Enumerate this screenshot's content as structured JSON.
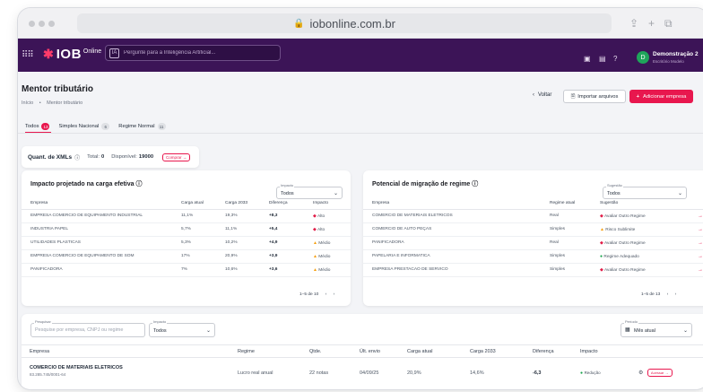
{
  "browser": {
    "url": "iobonline.com.br"
  },
  "nav": {
    "logo_brand": "IOB",
    "logo_suffix": "Online",
    "ai_placeholder": "Pergunte para a Inteligência Artificial...",
    "user_initial": "D",
    "user_name": "Demonstração 2",
    "user_company": "Escritório Modelo"
  },
  "header": {
    "title": "Mentor tributário",
    "breadcrumb": [
      "Início",
      "•",
      "Mentor tributário"
    ],
    "back_label": "Voltar",
    "import_label": "Importar arquivos",
    "add_label": "Adicionar empresa"
  },
  "tabs": [
    {
      "label": "Todos",
      "count": "13"
    },
    {
      "label": "Simples Nacional",
      "count": "6"
    },
    {
      "label": "Regime Normal",
      "count": "11"
    }
  ],
  "xml_quota": {
    "label": "Quant. de XMLs",
    "total_label": "Total:",
    "total_value": "0",
    "available_label": "Disponível:",
    "available_value": "19000",
    "buy_label": "Comprar"
  },
  "impact_card": {
    "title": "Impacto projetado na carga efetiva",
    "filter_label": "Impacto",
    "filter_value": "Todos",
    "columns": [
      "Empresa",
      "Carga atual",
      "Carga 2033",
      "Diferença",
      "Impacto"
    ],
    "rows": [
      {
        "empresa": "EMPRESA COMERCIO DE EQUIPAMENTO INDUSTRIAL",
        "atual": "11,1%",
        "c2033": "19,3%",
        "dif": "+8,3",
        "impacto": "Alto",
        "level": "high"
      },
      {
        "empresa": "INDUSTRIA PAPEL",
        "atual": "5,7%",
        "c2033": "11,1%",
        "dif": "+5,4",
        "impacto": "Alto",
        "level": "high"
      },
      {
        "empresa": "UTILIDADES PLASTICAS",
        "atual": "5,3%",
        "c2033": "10,2%",
        "dif": "+4,9",
        "impacto": "Médio",
        "level": "medium"
      },
      {
        "empresa": "EMPRESA COMERCIO DE EQUIPAMENTO DE SOM",
        "atual": "17%",
        "c2033": "20,9%",
        "dif": "+3,9",
        "impacto": "Médio",
        "level": "medium"
      },
      {
        "empresa": "PANIFICADORA",
        "atual": "7%",
        "c2033": "10,6%",
        "dif": "+3,6",
        "impacto": "Médio",
        "level": "medium"
      }
    ],
    "pagination": "1–5 de 10"
  },
  "migration_card": {
    "title": "Potencial de migração de regime",
    "filter_label": "Sugestão",
    "filter_value": "Todos",
    "columns": [
      "Empresa",
      "Regime atual",
      "Sugestão"
    ],
    "rows": [
      {
        "empresa": "COMERCIO DE MATERIAIS ELETRICOS",
        "regime": "Real",
        "sugestao": "Avaliar Outro Regime",
        "level": "high"
      },
      {
        "empresa": "COMERCIO DE AUTO PEÇAS",
        "regime": "Simples",
        "sugestao": "Risco Sublimite",
        "level": "medium"
      },
      {
        "empresa": "PANIFICADORA",
        "regime": "Real",
        "sugestao": "Avaliar Outro Regime",
        "level": "high"
      },
      {
        "empresa": "PAPELARIA E INFORMATICA",
        "regime": "Simples",
        "sugestao": "Regime Adequado",
        "level": "ok"
      },
      {
        "empresa": "EMPRESA PRESTACAO DE SERVICO",
        "regime": "Simples",
        "sugestao": "Avaliar Outro Regime",
        "level": "high"
      }
    ],
    "pagination": "1–5 de 13"
  },
  "bottom": {
    "search_label": "Pesquisar",
    "search_placeholder": "Pesquise por empresa, CNPJ ou regime",
    "impact_label": "Impacto",
    "impact_value": "Todos",
    "period_label": "Período",
    "period_value": "Mês atual",
    "columns": [
      "Empresa",
      "Regime",
      "Qtde.",
      "Últ. envio",
      "Carga atual",
      "Carga 2033",
      "Diferença",
      "Impacto"
    ],
    "rows": [
      {
        "empresa": "COMERCIO DE MATERIAIS ELETRICOS",
        "cnpj": "83.285.745/0001-64",
        "regime": "Lucro real anual",
        "qtde": "22 notas",
        "envio": "04/09/25",
        "atual": "20,9%",
        "c2033": "14,6%",
        "dif": "-6,3",
        "impacto": "Redução",
        "action": "Acessar"
      }
    ]
  }
}
